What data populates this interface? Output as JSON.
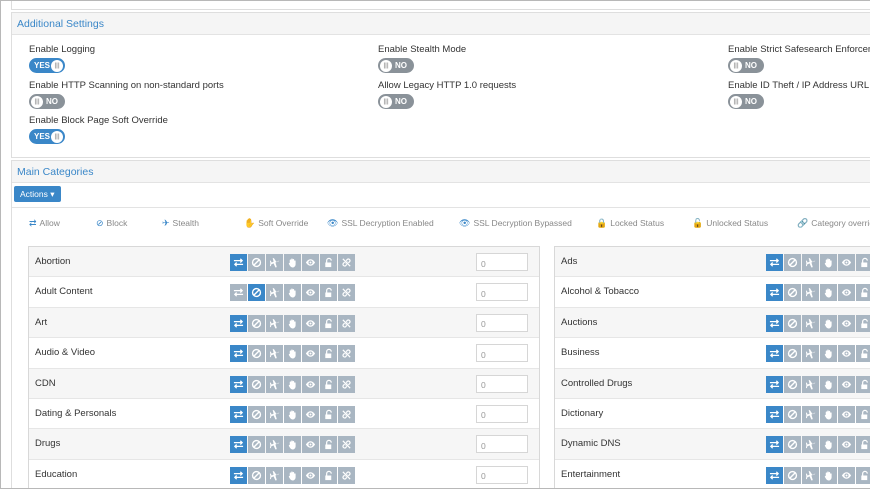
{
  "additional_settings": {
    "title": "Additional Settings",
    "settings": [
      {
        "label": "Enable Logging",
        "value": "YES",
        "on": true
      },
      {
        "label": "Enable Stealth Mode",
        "value": "NO",
        "on": false
      },
      {
        "label": "Enable Strict Safesearch Enforcement",
        "value": "NO",
        "on": false
      },
      {
        "label": "Enable HTTP Scanning on non-standard ports",
        "value": "NO",
        "on": false
      },
      {
        "label": "Allow Legacy HTTP 1.0 requests",
        "value": "NO",
        "on": false
      },
      {
        "label": "Enable ID Theft / IP Address URL Blocking",
        "value": "NO",
        "on": false
      },
      {
        "label": "Enable Block Page Soft Override",
        "value": "YES",
        "on": true
      }
    ]
  },
  "main_categories": {
    "title": "Main Categories",
    "actions_label": "Actions",
    "legend": [
      "Allow",
      "Block",
      "Stealth",
      "Soft Override",
      "SSL Decryption Enabled",
      "SSL Decryption Bypassed",
      "Locked Status",
      "Unlocked Status",
      "Category override"
    ],
    "left": [
      {
        "name": "Abortion",
        "state": "allow",
        "count": "0"
      },
      {
        "name": "Adult Content",
        "state": "block",
        "count": "0"
      },
      {
        "name": "Art",
        "state": "allow",
        "count": "0"
      },
      {
        "name": "Audio & Video",
        "state": "allow",
        "count": "0"
      },
      {
        "name": "CDN",
        "state": "allow",
        "count": "0"
      },
      {
        "name": "Dating & Personals",
        "state": "allow",
        "count": "0"
      },
      {
        "name": "Drugs",
        "state": "allow",
        "count": "0"
      },
      {
        "name": "Education",
        "state": "allow",
        "count": "0"
      }
    ],
    "right": [
      {
        "name": "Ads",
        "state": "allow"
      },
      {
        "name": "Alcohol & Tobacco",
        "state": "allow"
      },
      {
        "name": "Auctions",
        "state": "allow"
      },
      {
        "name": "Business",
        "state": "allow"
      },
      {
        "name": "Controlled Drugs",
        "state": "allow"
      },
      {
        "name": "Dictionary",
        "state": "allow"
      },
      {
        "name": "Dynamic DNS",
        "state": "allow"
      },
      {
        "name": "Entertainment",
        "state": "allow"
      }
    ]
  },
  "colors": {
    "accent": "#3a87c8",
    "inactive_icon": "#a9b6c2",
    "toggle_off": "#8a9299"
  },
  "icons": [
    "allow-icon",
    "block-icon",
    "stealth-icon",
    "soft-override-icon",
    "ssl-enabled-icon",
    "lock-icon",
    "category-override-icon"
  ]
}
